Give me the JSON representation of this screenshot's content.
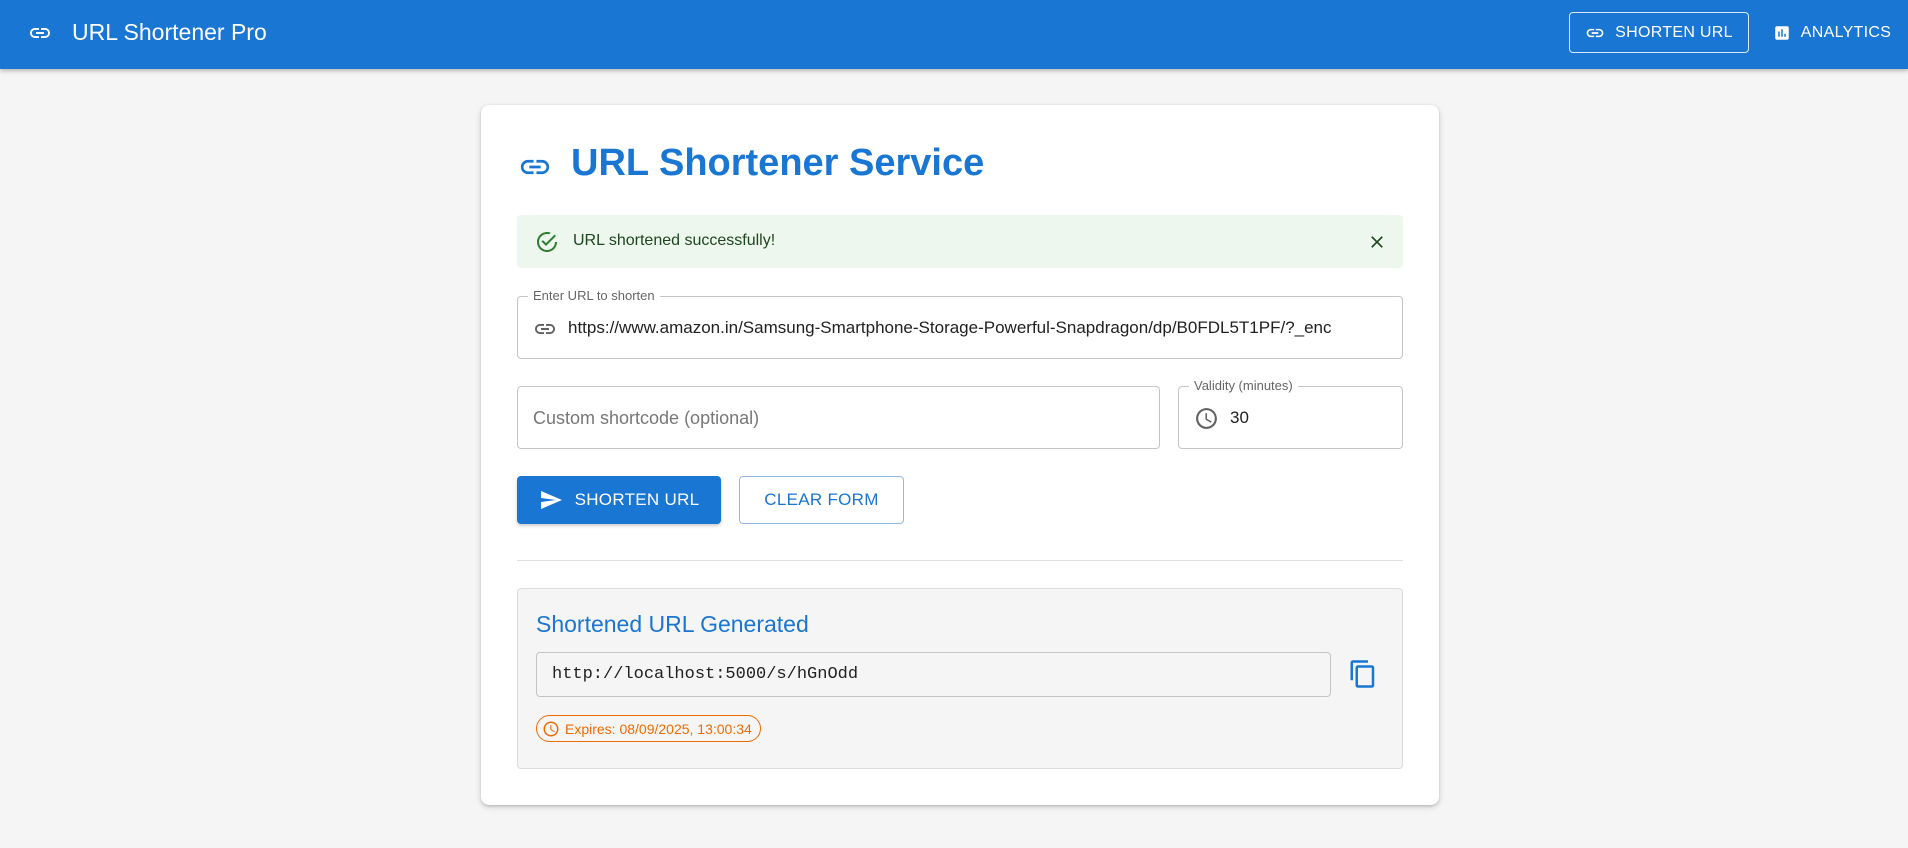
{
  "appbar": {
    "title": "URL Shortener Pro",
    "nav": {
      "shorten_label": "SHORTEN URL",
      "analytics_label": "ANALYTICS"
    }
  },
  "page": {
    "title": "URL Shortener Service"
  },
  "alert": {
    "message": "URL shortened successfully!"
  },
  "form": {
    "url_label": "Enter URL to shorten",
    "url_value": "https://www.amazon.in/Samsung-Smartphone-Storage-Powerful-Snapdragon/dp/B0FDL5T1PF/?_enc",
    "shortcode_placeholder": "Custom shortcode (optional)",
    "validity_label": "Validity (minutes)",
    "validity_value": "30",
    "submit_label": "SHORTEN URL",
    "clear_label": "CLEAR FORM"
  },
  "result": {
    "title": "Shortened URL Generated",
    "short_url": "http://localhost:5000/s/hGnOdd",
    "expires": "Expires: 08/09/2025, 13:00:34"
  },
  "colors": {
    "primary": "#1976d2",
    "success_bg": "#edf7ed",
    "success_icon": "#2e7d32",
    "warning": "#ed6c02",
    "background": "#f5f5f5"
  },
  "icons": {
    "logo": "link-icon",
    "nav_shorten": "link-icon",
    "nav_analytics": "bar-chart-icon",
    "alert": "check-circle-icon",
    "alert_close": "close-icon",
    "url_adornment": "link-icon",
    "validity_adornment": "clock-icon",
    "submit": "send-icon",
    "copy": "copy-icon",
    "expires": "clock-icon"
  }
}
